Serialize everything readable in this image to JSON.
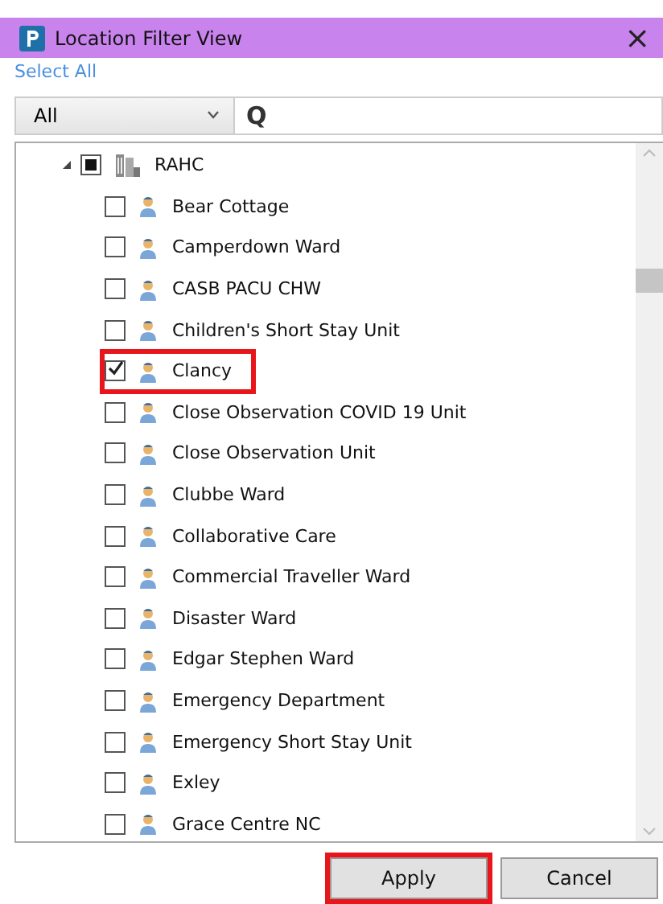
{
  "window": {
    "title": "Location Filter View",
    "close": "×"
  },
  "select_all": "Select All",
  "filter": {
    "value": "All"
  },
  "search": {
    "glyph": "Q"
  },
  "tree": [
    {
      "label": "RAHC",
      "expanded": true,
      "checked": false,
      "indeterminate": true,
      "children": [
        {
          "label": "Bear Cottage",
          "checked": false,
          "highlighted": false
        },
        {
          "label": "Camperdown Ward",
          "checked": false,
          "highlighted": false
        },
        {
          "label": "CASB PACU CHW",
          "checked": false,
          "highlighted": false
        },
        {
          "label": "Children's Short Stay Unit",
          "checked": false,
          "highlighted": false
        },
        {
          "label": "Clancy",
          "checked": true,
          "highlighted": true
        },
        {
          "label": "Close Observation COVID 19 Unit",
          "checked": false,
          "highlighted": false
        },
        {
          "label": "Close Observation Unit",
          "checked": false,
          "highlighted": false
        },
        {
          "label": "Clubbe Ward",
          "checked": false,
          "highlighted": false
        },
        {
          "label": "Collaborative Care",
          "checked": false,
          "highlighted": false
        },
        {
          "label": "Commercial Traveller Ward",
          "checked": false,
          "highlighted": false
        },
        {
          "label": "Disaster Ward",
          "checked": false,
          "highlighted": false
        },
        {
          "label": "Edgar Stephen Ward",
          "checked": false,
          "highlighted": false
        },
        {
          "label": "Emergency Department",
          "checked": false,
          "highlighted": false
        },
        {
          "label": "Emergency Short Stay Unit",
          "checked": false,
          "highlighted": false
        },
        {
          "label": "Exley",
          "checked": false,
          "highlighted": false
        },
        {
          "label": "Grace Centre NC",
          "checked": false,
          "highlighted": false
        }
      ]
    }
  ],
  "buttons": [
    {
      "label": "Apply",
      "highlighted": true
    },
    {
      "label": "Cancel",
      "highlighted": false
    }
  ]
}
